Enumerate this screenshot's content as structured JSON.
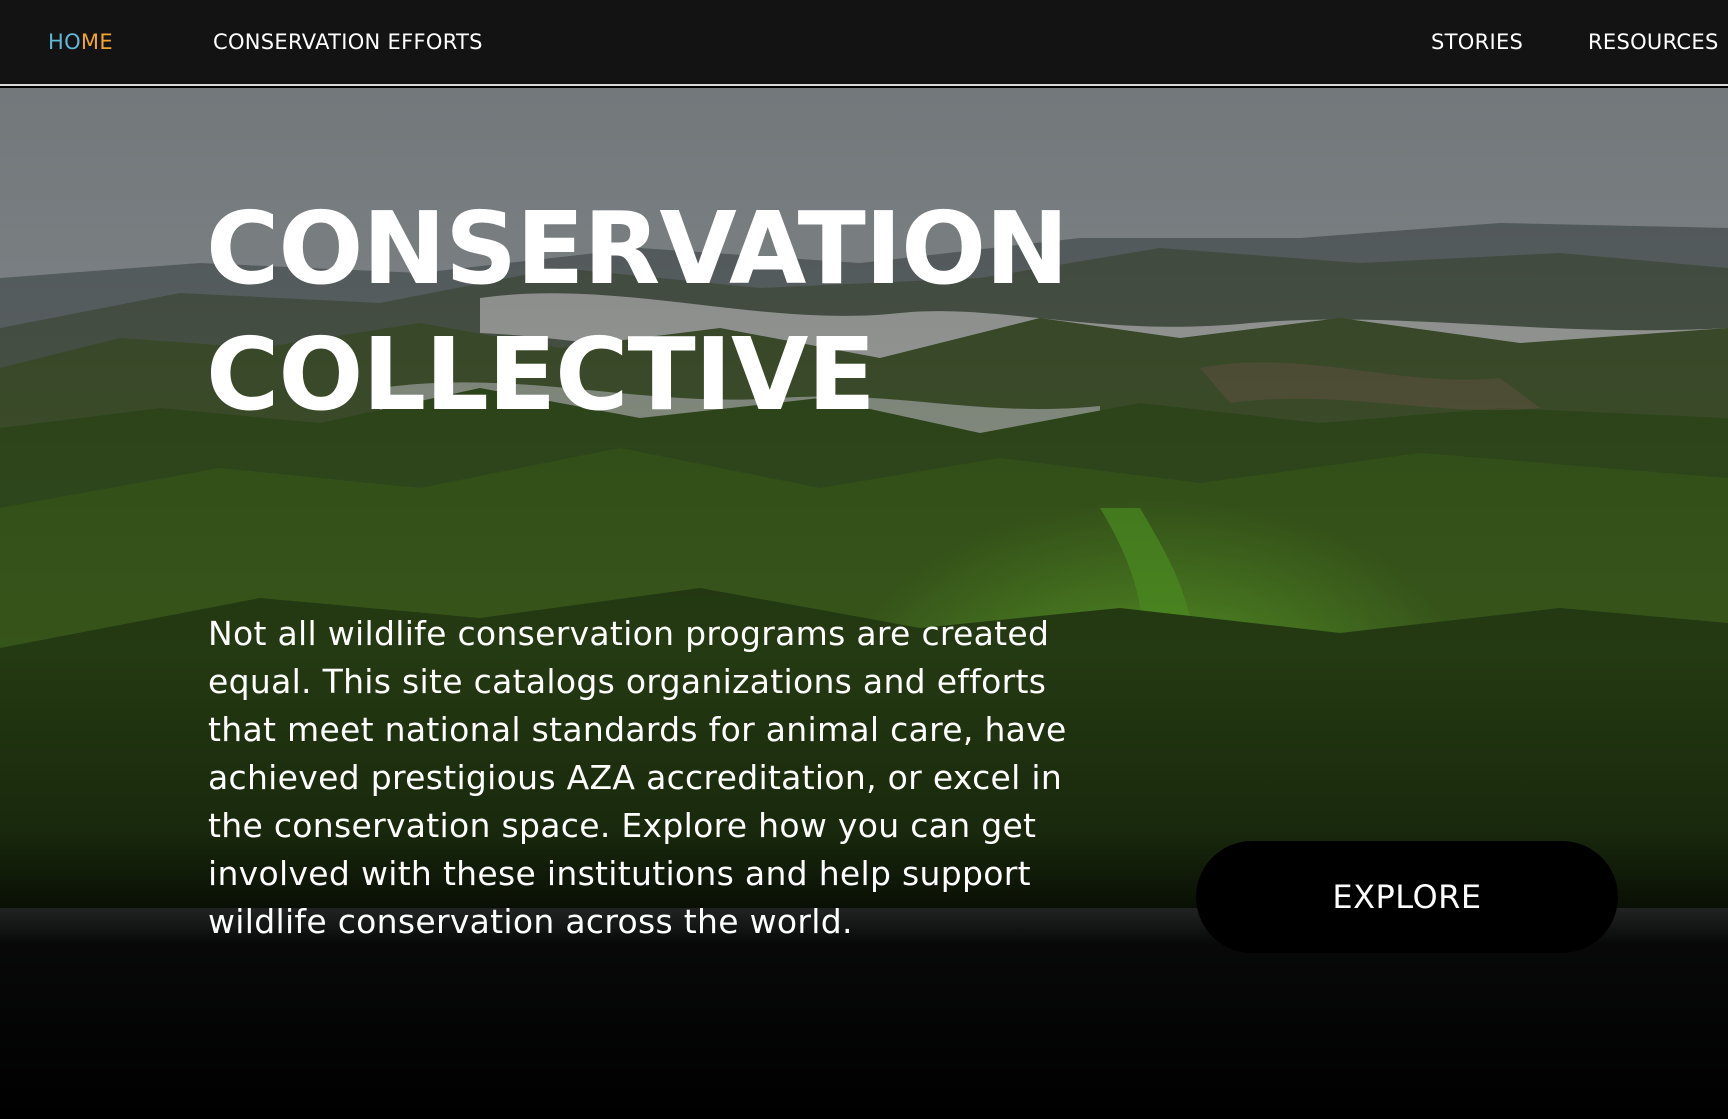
{
  "nav": {
    "home_part1": "HO",
    "home_part2": "ME",
    "conservation_efforts": "CONSERVATION EFFORTS",
    "stories": "STORIES",
    "resources": "RESOURCES"
  },
  "hero": {
    "title_line1": "CONSERVATION",
    "title_line2": "COLLECTIVE",
    "description": "Not all wildlife conservation programs are created equal. This site catalogs organizations and efforts that meet national standards for animal care, have achieved prestigious AZA accreditation, or excel in the conservation space. Explore how you can get involved with these institutions and help support wildlife conservation across the world.",
    "explore_label": "EXPLORE",
    "background_image": "forested-mountain-valley-photo"
  },
  "colors": {
    "nav_background": "#131313",
    "home_accent_blue": "#5fb6d6",
    "home_accent_orange": "#f2a52a",
    "button_background": "#000000",
    "text": "#ffffff"
  }
}
